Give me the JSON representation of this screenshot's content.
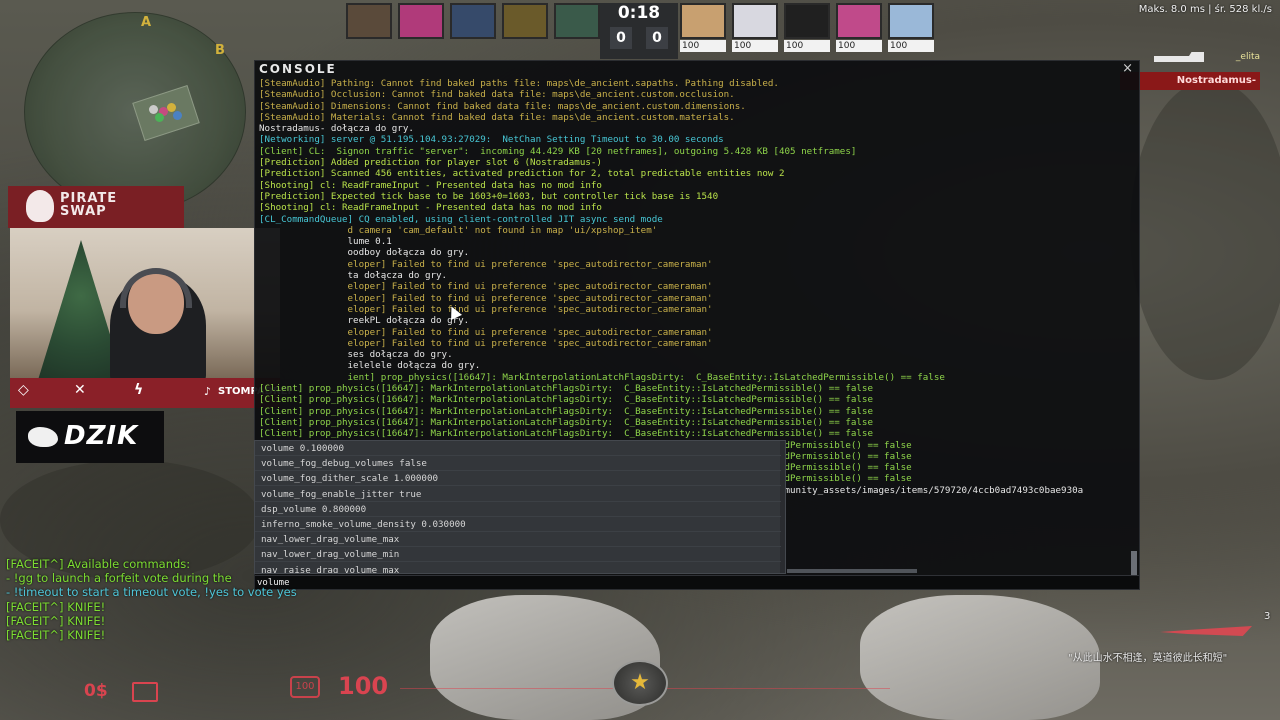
{
  "minimap": {
    "site_a": "A",
    "site_b": "B"
  },
  "scoreboard": {
    "timer": "0:18",
    "score_ct": "0",
    "score_t": "0",
    "left_team": [
      {
        "color": "#5a4a3a"
      },
      {
        "color": "#b03a7a"
      },
      {
        "color": "#364a6a"
      },
      {
        "color": "#6a5a2a"
      },
      {
        "color": "#3a5a4a"
      }
    ],
    "right_team": [
      {
        "hp": "100",
        "color": "#c8a070"
      },
      {
        "hp": "100",
        "color": "#d8d8e0"
      },
      {
        "hp": "100",
        "color": "#202020"
      },
      {
        "hp": "100",
        "color": "#c04a8a"
      },
      {
        "hp": "100",
        "color": "#9ab8d8"
      }
    ]
  },
  "net_stats": "Maks.  8.0 ms | śr. 528 kl./s",
  "killfeed": {
    "victim": "_elita",
    "killer": "Nostradamus-"
  },
  "streamer": {
    "sponsor": "PIRATE\nSWAP",
    "social_handle": "STOMPADREI",
    "sponsor2": "DZIK"
  },
  "console": {
    "title": "CONSOLE",
    "close": "×",
    "input_value": "volume",
    "lines": [
      {
        "text": "[SteamAudio] Pathing: Cannot find baked paths file: maps\\de_ancient.sapaths. Pathing disabled.",
        "color": "yellow"
      },
      {
        "text": "[SteamAudio] Occlusion: Cannot find baked data file: maps\\de_ancient.custom.occlusion.",
        "color": "yellow"
      },
      {
        "text": "[SteamAudio] Dimensions: Cannot find baked data file: maps\\de_ancient.custom.dimensions.",
        "color": "yellow"
      },
      {
        "text": "[SteamAudio] Materials: Cannot find baked data file: maps\\de_ancient.custom.materials.",
        "color": "yellow"
      },
      {
        "text": "Nostradamus- dołącza do gry.",
        "color": "white"
      },
      {
        "text": "[Networking] server @ 51.195.104.93:27029:  NetChan Setting Timeout to 30.00 seconds",
        "color": "cyan"
      },
      {
        "text": "[Client] CL:  Signon traffic \"server\":  incoming 44.429 KB [20 netframes], outgoing 5.428 KB [405 netframes]",
        "color": "green"
      },
      {
        "text": "[Prediction] Added prediction for player slot 6 (Nostradamus-)",
        "color": "lime"
      },
      {
        "text": "[Prediction] Scanned 456 entities, activated prediction for 2, total predictable entities now 2",
        "color": "lime"
      },
      {
        "text": "[Shooting] cl: ReadFrameInput - Presented data has no mod info",
        "color": "lime"
      },
      {
        "text": "[Prediction] Expected tick base to be 1603+0=1603, but controller tick base is 1540",
        "color": "lime"
      },
      {
        "text": "[Shooting] cl: ReadFrameInput - Presented data has no mod info",
        "color": "lime"
      },
      {
        "text": "[CL_CommandQueue] CQ enabled, using client-controlled JIT async send mode",
        "color": "cyan"
      },
      {
        "text": "                d camera 'cam_default' not found in map 'ui/xpshop_item'",
        "color": "yellow"
      },
      {
        "text": "                lume 0.1",
        "color": "white"
      },
      {
        "text": "                oodboy dołącza do gry.",
        "color": "white"
      },
      {
        "text": "                eloper] Failed to find ui preference 'spec_autodirector_cameraman'",
        "color": "yellow"
      },
      {
        "text": "                ta dołącza do gry.",
        "color": "white"
      },
      {
        "text": "                eloper] Failed to find ui preference 'spec_autodirector_cameraman'",
        "color": "yellow"
      },
      {
        "text": "                eloper] Failed to find ui preference 'spec_autodirector_cameraman'",
        "color": "yellow"
      },
      {
        "text": "                eloper] Failed to find ui preference 'spec_autodirector_cameraman'",
        "color": "yellow"
      },
      {
        "text": "                reekPL dołącza do gry.",
        "color": "white"
      },
      {
        "text": "                eloper] Failed to find ui preference 'spec_autodirector_cameraman'",
        "color": "yellow"
      },
      {
        "text": "                eloper] Failed to find ui preference 'spec_autodirector_cameraman'",
        "color": "yellow"
      },
      {
        "text": "                ses dołącza do gry.",
        "color": "white"
      },
      {
        "text": "                ielelele dołącza do gry.",
        "color": "white"
      },
      {
        "text": "                ient] prop_physics([16647]: MarkInterpolationLatchFlagsDirty:  C_BaseEntity::IsLatchedPermissible() == false",
        "color": "green"
      },
      {
        "text": "[Client] prop_physics([16647]: MarkInterpolationLatchFlagsDirty:  C_BaseEntity::IsLatchedPermissible() == false",
        "color": "green"
      },
      {
        "text": "[Client] prop_physics([16647]: MarkInterpolationLatchFlagsDirty:  C_BaseEntity::IsLatchedPermissible() == false",
        "color": "green"
      },
      {
        "text": "[Client] prop_physics([16647]: MarkInterpolationLatchFlagsDirty:  C_BaseEntity::IsLatchedPermissible() == false",
        "color": "green"
      },
      {
        "text": "[Client] prop_physics([16647]: MarkInterpolationLatchFlagsDirty:  C_BaseEntity::IsLatchedPermissible() == false",
        "color": "green"
      },
      {
        "text": "[Client] prop_physics([16647]: MarkInterpolationLatchFlagsDirty:  C_BaseEntity::IsLatchedPermissible() == false",
        "color": "green"
      },
      {
        "text": "                                                                                            chedPermissible() == false",
        "color": "green"
      },
      {
        "text": "                                                                                            chedPermissible() == false",
        "color": "green"
      },
      {
        "text": "                                                                                            chedPermissible() == false",
        "color": "green"
      },
      {
        "text": "                                                                                            chedPermissible() == false",
        "color": "green"
      },
      {
        "text": "                                                                                            community_assets/images/items/579720/4ccb0ad7493c0bae930a",
        "color": "white"
      }
    ]
  },
  "autocomplete": [
    "volume 0.100000",
    "volume_fog_debug_volumes false",
    "volume_fog_dither_scale 1.000000",
    "volume_fog_enable_jitter true",
    "dsp_volume 0.800000",
    "inferno_smoke_volume_density 0.030000",
    "nav_lower_drag_volume_max",
    "nav_lower_drag_volume_min",
    "nav_raise_drag_volume_max"
  ],
  "chat": [
    {
      "text": "[FACEIT^] Available commands:",
      "kind": "faceit"
    },
    {
      "text": "- !gg to launch a forfeit vote during the",
      "kind": "faceit"
    },
    {
      "text": "- !timeout to start a timeout vote, !yes to vote yes",
      "kind": "cmd"
    },
    {
      "text": "[FACEIT^] KNIFE!",
      "kind": "faceit"
    },
    {
      "text": "[FACEIT^] KNIFE!",
      "kind": "faceit"
    },
    {
      "text": "[FACEIT^] KNIFE!",
      "kind": "faceit"
    }
  ],
  "hud": {
    "money": "0$",
    "armor": "100",
    "health": "100",
    "round_count": "3",
    "quote": "\"从此山水不相逢，莫道彼此长和短\""
  }
}
